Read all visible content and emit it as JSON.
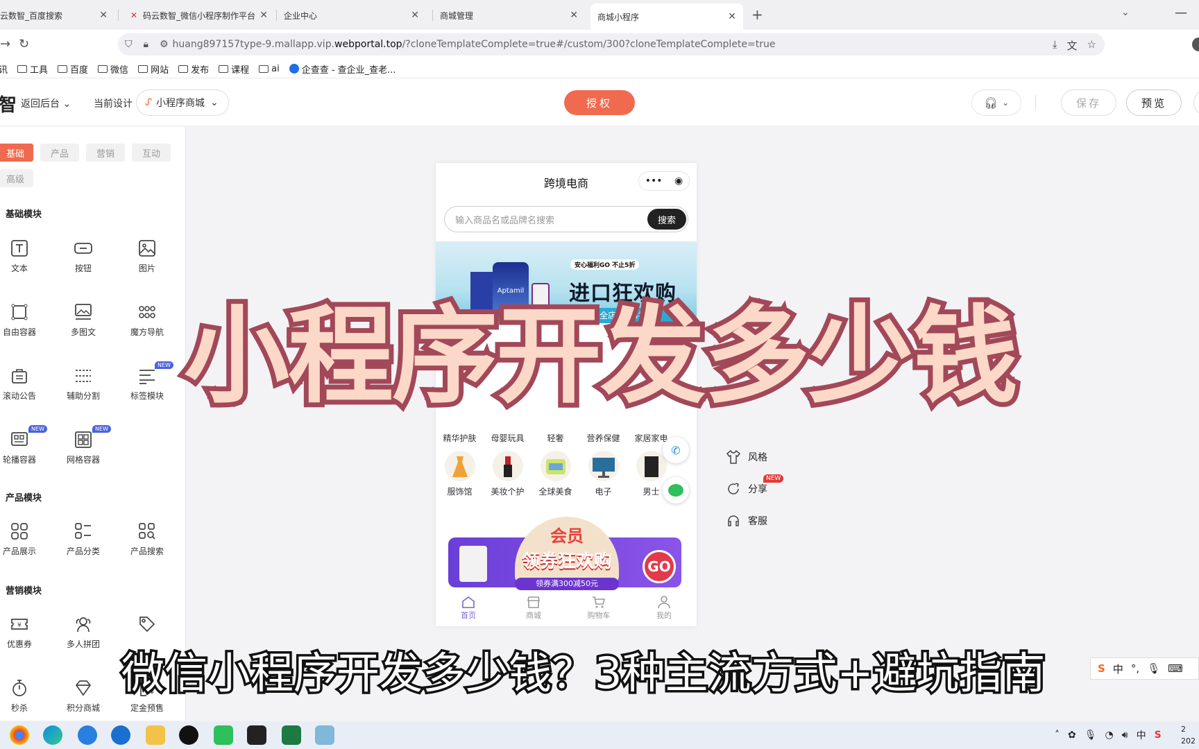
{
  "browser": {
    "tabs": [
      {
        "label": "云数智_百度搜索",
        "fav": "baidu-icon"
      },
      {
        "label": "码云数智_微信小程序制作平台",
        "fav": "mayun-logo-icon"
      },
      {
        "label": "企业中心",
        "fav": ""
      },
      {
        "label": "商城管理",
        "fav": ""
      },
      {
        "label": "商城小程序",
        "fav": ""
      }
    ],
    "url_prefix": "huang897157type-9.mallapp.vip.",
    "url_host": "webportal.top",
    "url_suffix": "/?cloneTemplateComplete=true#/custom/300?cloneTemplateComplete=true",
    "bookmarks": [
      "讯",
      "工具",
      "百度",
      "微信",
      "网站",
      "发布",
      "课程",
      "ai",
      "企查查 - 查企业_查老..."
    ]
  },
  "app_header": {
    "logo_fragment": "智",
    "back_label": "返回后台",
    "current_design_label": "当前设计",
    "design_select_value": "小程序商城",
    "auth_label": "授权",
    "save_label": "保存",
    "preview_label": "预览",
    "accent_color": "#f06a4f"
  },
  "left_panel": {
    "tabs": [
      "基础",
      "产品",
      "营销",
      "互动",
      "高级"
    ],
    "sections": {
      "basic": "基础模块",
      "product": "产品模块",
      "marketing": "营销模块"
    },
    "basic_modules": [
      "文本",
      "按钮",
      "图片",
      "自由容器",
      "多图文",
      "魔方导航",
      "滚动公告",
      "辅助分割",
      "标签模块",
      "轮播容器",
      "网格容器"
    ],
    "product_modules": [
      "产品展示",
      "产品分类",
      "产品搜索"
    ],
    "marketing_modules": [
      "优惠券",
      "多人拼团",
      "",
      "秒杀",
      "积分商城",
      "定金预售"
    ],
    "new_badge": "NEW"
  },
  "phone": {
    "title": "跨境电商",
    "search_placeholder": "输入商品名或品牌名搜索",
    "search_button": "搜索",
    "banner": {
      "tag": "安心福利GO  不止5折",
      "headline": "进口狂欢购",
      "pill": "全店低至5折起",
      "brand": "Aptamil"
    },
    "categories_row1": [
      "精华护肤",
      "母婴玩具",
      "轻奢",
      "营养保健",
      "家居家电"
    ],
    "categories_row2": [
      "服饰馆",
      "美妆个护",
      "全球美食",
      "电子",
      "男士"
    ],
    "coupon": {
      "line1": "会员",
      "line2": "领券狂欢购",
      "sub": "领券满300减50元",
      "go": "GO"
    },
    "tabbar": [
      "首页",
      "商城",
      "购物车",
      "我的"
    ]
  },
  "right_settings": {
    "items": [
      "风格",
      "分享",
      "客服"
    ],
    "share_badge": "NEW"
  },
  "overlay": {
    "headline": "小程序开发多少钱",
    "subtitle": "微信小程序开发多少钱？3种主流方式+避坑指南"
  },
  "ime": {
    "brand": "S",
    "lang": "中",
    "punct": "°,"
  },
  "taskbar": {
    "tray_lang": "中",
    "clock_time": "2",
    "clock_date": "202"
  }
}
